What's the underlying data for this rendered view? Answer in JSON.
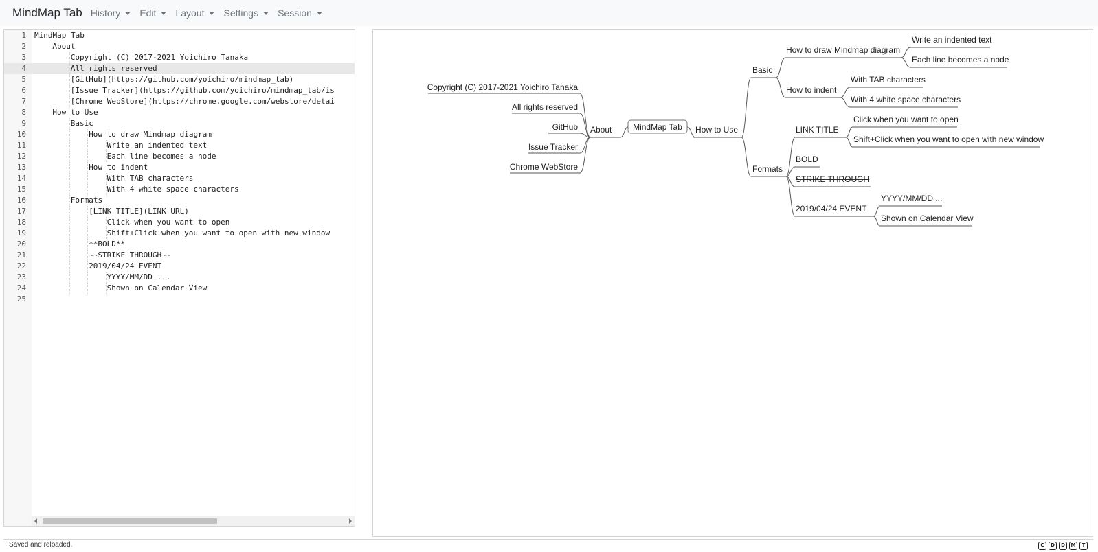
{
  "navbar": {
    "brand": "MindMap Tab",
    "menus": [
      {
        "label": "History"
      },
      {
        "label": "Edit"
      },
      {
        "label": "Layout"
      },
      {
        "label": "Settings"
      },
      {
        "label": "Session"
      }
    ]
  },
  "editor": {
    "active_line": 4,
    "lines": [
      {
        "num": "1",
        "indent": 0,
        "text": "MindMap Tab"
      },
      {
        "num": "2",
        "indent": 1,
        "text": "About"
      },
      {
        "num": "3",
        "indent": 2,
        "text": "Copyright (C) 2017-2021 Yoichiro Tanaka"
      },
      {
        "num": "4",
        "indent": 2,
        "text": "All rights reserved"
      },
      {
        "num": "5",
        "indent": 2,
        "text": "[GitHub](https://github.com/yoichiro/mindmap_tab)"
      },
      {
        "num": "6",
        "indent": 2,
        "text": "[Issue Tracker](https://github.com/yoichiro/mindmap_tab/is"
      },
      {
        "num": "7",
        "indent": 2,
        "text": "[Chrome WebStore](https://chrome.google.com/webstore/detai"
      },
      {
        "num": "8",
        "indent": 1,
        "text": "How to Use"
      },
      {
        "num": "9",
        "indent": 2,
        "text": "Basic"
      },
      {
        "num": "10",
        "indent": 3,
        "text": "How to draw Mindmap diagram"
      },
      {
        "num": "11",
        "indent": 4,
        "text": "Write an indented text"
      },
      {
        "num": "12",
        "indent": 4,
        "text": "Each line becomes a node"
      },
      {
        "num": "13",
        "indent": 3,
        "text": "How to indent"
      },
      {
        "num": "14",
        "indent": 4,
        "text": "With TAB characters"
      },
      {
        "num": "15",
        "indent": 4,
        "text": "With 4 white space characters"
      },
      {
        "num": "16",
        "indent": 2,
        "text": "Formats"
      },
      {
        "num": "17",
        "indent": 3,
        "text": "[LINK TITLE](LINK URL)"
      },
      {
        "num": "18",
        "indent": 4,
        "text": "Click when you want to open"
      },
      {
        "num": "19",
        "indent": 4,
        "text": "Shift+Click when you want to open with new window"
      },
      {
        "num": "20",
        "indent": 3,
        "text": "**BOLD**"
      },
      {
        "num": "21",
        "indent": 3,
        "text": "~~STRIKE THROUGH~~"
      },
      {
        "num": "22",
        "indent": 3,
        "text": "2019/04/24 EVENT"
      },
      {
        "num": "23",
        "indent": 4,
        "text": "YYYY/MM/DD ..."
      },
      {
        "num": "24",
        "indent": 4,
        "text": "Shown on Calendar View"
      },
      {
        "num": "25",
        "indent": 0,
        "text": ""
      }
    ]
  },
  "mindmap": {
    "root": "MindMap Tab",
    "about": {
      "label": "About",
      "children": [
        {
          "label": "Copyright (C) 2017-2021 Yoichiro Tanaka",
          "style": "normal"
        },
        {
          "label": "All rights reserved",
          "style": "normal"
        },
        {
          "label": "GitHub",
          "style": "link"
        },
        {
          "label": "Issue Tracker",
          "style": "link"
        },
        {
          "label": "Chrome WebStore",
          "style": "link"
        }
      ]
    },
    "how_to_use": {
      "label": "How to Use",
      "basic": {
        "label": "Basic",
        "draw": {
          "label": "How to draw Mindmap diagram",
          "children": [
            "Write an indented text",
            "Each line becomes a node"
          ]
        },
        "indent": {
          "label": "How to indent",
          "children": [
            "With TAB characters",
            "With 4 white space characters"
          ]
        }
      },
      "formats": {
        "label": "Formats",
        "link": {
          "label": "LINK TITLE",
          "children": [
            "Click when you want to open",
            "Shift+Click when you want to open with new window"
          ]
        },
        "bold": "BOLD",
        "strike": "STRIKE THROUGH",
        "event": {
          "label": "2019/04/24 EVENT",
          "children": [
            "YYYY/MM/DD ...",
            "Shown on Calendar View"
          ]
        }
      }
    },
    "colors": {
      "line": "#555555",
      "link": "#2b3aa8",
      "bold": "#d13a3a",
      "strike": "#c8c8c8",
      "text": "#222222"
    }
  },
  "status": {
    "message": "Saved and reloaded.",
    "badges": [
      "C",
      "D",
      "D",
      "M",
      "T"
    ]
  }
}
